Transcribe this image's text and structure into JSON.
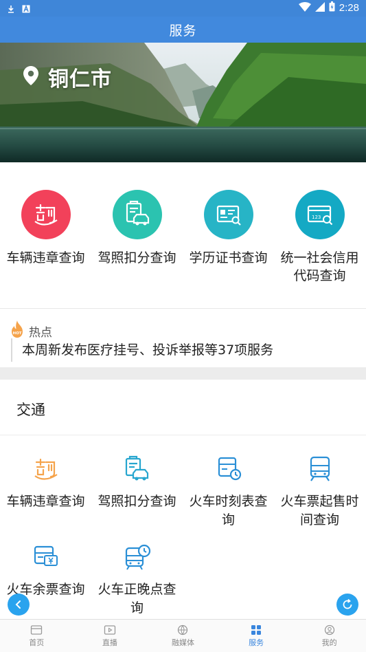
{
  "status_bar": {
    "time": "2:28"
  },
  "header": {
    "title": "服务"
  },
  "banner": {
    "city": "铜仁市"
  },
  "quick_services": [
    {
      "label": "车辆违章查询",
      "icon": "violation-icon",
      "color": "#f2415a"
    },
    {
      "label": "驾照扣分查询",
      "icon": "license-car-icon",
      "color": "#2bc3b0"
    },
    {
      "label": "学历证书查询",
      "icon": "certificate-icon",
      "color": "#27b4c6"
    },
    {
      "label": "统一社会信用代码查询",
      "icon": "credit-code-icon",
      "color": "#14a9c4"
    }
  ],
  "hot": {
    "title": "热点",
    "badge": "HOT",
    "text": "本周新发布医疗挂号、投诉举报等37项服务"
  },
  "section": {
    "title": "交通",
    "items": [
      {
        "label": "车辆违章查询",
        "icon": "violation-icon"
      },
      {
        "label": "驾照扣分查询",
        "icon": "license-car-icon"
      },
      {
        "label": "火车时刻表查询",
        "icon": "train-schedule-icon"
      },
      {
        "label": "火车票起售时间查询",
        "icon": "train-icon"
      },
      {
        "label": "火车余票查询",
        "icon": "ticket-icon"
      },
      {
        "label": "火车正晚点查询",
        "icon": "train-clock-icon"
      }
    ]
  },
  "nav": [
    {
      "label": "首页",
      "icon": "home-icon"
    },
    {
      "label": "直播",
      "icon": "live-icon"
    },
    {
      "label": "融媒体",
      "icon": "media-icon"
    },
    {
      "label": "服务",
      "icon": "service-grid-icon",
      "active": true
    },
    {
      "label": "我的",
      "icon": "profile-icon"
    }
  ],
  "colors": {
    "primary": "#4189dd",
    "accent_orange": "#f5a34b",
    "accent_blue": "#2aa3ee"
  }
}
